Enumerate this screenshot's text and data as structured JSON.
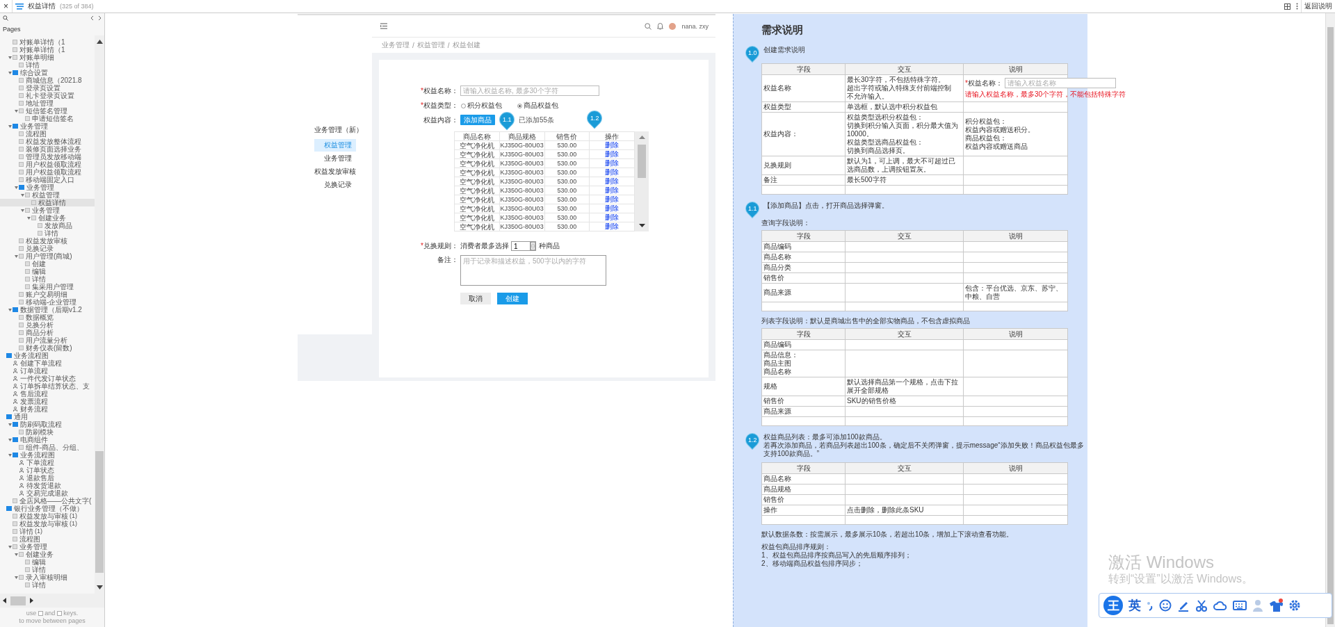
{
  "topbar": {
    "close": "×",
    "page_title": "权益详情",
    "page_count": "(325 of 384)",
    "action": "返回说明"
  },
  "sidebar": {
    "pages_label": "Pages",
    "scrolled_branch": [
      {
        "label": "对账单详情（1",
        "kind": "page",
        "selected": false
      },
      {
        "label": "对账单详情（1",
        "kind": "page",
        "selected": false
      },
      {
        "label": "对账单明细",
        "kind": "page",
        "selected": false,
        "expanded": true,
        "children": [
          {
            "label": "详情",
            "kind": "page",
            "selected": false
          }
        ]
      },
      {
        "label": "综合设置",
        "kind": "folder",
        "selected": false,
        "expanded": true,
        "children": [
          {
            "label": "商城信息（2021.8",
            "kind": "page",
            "selected": false
          },
          {
            "label": "登录页设置",
            "kind": "page",
            "selected": false
          },
          {
            "label": "礼卡登录页设置",
            "kind": "page",
            "selected": false
          },
          {
            "label": "地址管理",
            "kind": "page",
            "selected": false
          },
          {
            "label": "短信签名管理",
            "kind": "page",
            "selected": false,
            "expanded": true,
            "children": [
              {
                "label": "申请短信签名",
                "kind": "page",
                "selected": false
              }
            ]
          }
        ]
      },
      {
        "label": "业务管理",
        "kind": "folder",
        "selected": false,
        "expanded": true,
        "children": [
          {
            "label": "流程图",
            "kind": "page",
            "selected": false
          },
          {
            "label": "权益发放整体流程",
            "kind": "page",
            "selected": false
          },
          {
            "label": "装修页面选择业务",
            "kind": "page",
            "selected": false
          },
          {
            "label": "管理员发放移动端",
            "kind": "page",
            "selected": false
          },
          {
            "label": "用户权益领取流程",
            "kind": "page",
            "selected": false
          },
          {
            "label": "用户权益领取流程",
            "kind": "page",
            "selected": false
          },
          {
            "label": "移动端固定入口",
            "kind": "page",
            "selected": false
          },
          {
            "label": "业务管理",
            "kind": "folder",
            "selected": false,
            "expanded": true,
            "children": [
              {
                "label": "权益管理",
                "kind": "page",
                "selected": false,
                "expanded": true,
                "children": [
                  {
                    "label": "权益详情",
                    "kind": "page",
                    "selected": true
                  }
                ]
              },
              {
                "label": "业务管理",
                "kind": "page",
                "selected": false,
                "expanded": true,
                "children": [
                  {
                    "label": "创建业务",
                    "kind": "page",
                    "selected": false,
                    "expanded": true,
                    "children": [
                      {
                        "label": "发放商品",
                        "kind": "page",
                        "selected": false
                      },
                      {
                        "label": "详情",
                        "kind": "page",
                        "selected": false
                      }
                    ]
                  }
                ]
              }
            ]
          },
          {
            "label": "权益发放审核",
            "kind": "page",
            "selected": false
          },
          {
            "label": "兑换记录",
            "kind": "page",
            "selected": false
          },
          {
            "label": "用户管理(商城)",
            "kind": "page",
            "selected": false,
            "expanded": true,
            "children": [
              {
                "label": "创建",
                "kind": "page",
                "selected": false
              },
              {
                "label": "编辑",
                "kind": "page",
                "selected": false
              },
              {
                "label": "详情",
                "kind": "page",
                "selected": false
              },
              {
                "label": "集采用户管理",
                "kind": "page",
                "selected": false
              }
            ]
          },
          {
            "label": "账户交易明细",
            "kind": "page",
            "selected": false
          },
          {
            "label": "移动端-企业管理",
            "kind": "page",
            "selected": false
          }
        ]
      },
      {
        "label": "数据管理（后期v1.2",
        "kind": "folder",
        "selected": false,
        "expanded": true,
        "children": [
          {
            "label": "数据概览",
            "kind": "page",
            "selected": false
          },
          {
            "label": "兑换分析",
            "kind": "page",
            "selected": false
          },
          {
            "label": "商品分析",
            "kind": "page",
            "selected": false
          },
          {
            "label": "用户流量分析",
            "kind": "page",
            "selected": false
          },
          {
            "label": "财务仪表(留数)",
            "kind": "page",
            "selected": false
          }
        ]
      }
    ],
    "tree": [
      {
        "label": "业务流程图",
        "kind": "folder",
        "selected": false,
        "children": [
          {
            "label": "创建下单流程",
            "kind": "flow",
            "selected": false
          },
          {
            "label": "订单流程",
            "kind": "flow",
            "selected": false
          },
          {
            "label": "一件代发订单状态",
            "kind": "flow",
            "selected": false
          },
          {
            "label": "订单拆单结算状态、支",
            "kind": "flow",
            "selected": false
          },
          {
            "label": "售后流程",
            "kind": "flow",
            "selected": false
          },
          {
            "label": "发票流程",
            "kind": "flow",
            "selected": false
          },
          {
            "label": "财务流程",
            "kind": "flow",
            "selected": false
          }
        ]
      },
      {
        "label": "通用",
        "kind": "folder",
        "selected": false,
        "children": [
          {
            "label": "防刷码取流程",
            "kind": "folder",
            "selected": false,
            "expanded": true,
            "children": [
              {
                "label": "防刷模块",
                "kind": "page",
                "selected": false
              }
            ]
          },
          {
            "label": "电商组件",
            "kind": "folder",
            "selected": false,
            "expanded": true,
            "children": [
              {
                "label": "组件-商品、分组、",
                "kind": "page",
                "selected": false
              }
            ]
          },
          {
            "label": "业务流程图",
            "kind": "folder",
            "selected": false,
            "expanded": true,
            "children": [
              {
                "label": "下单流程",
                "kind": "flow",
                "selected": false
              },
              {
                "label": "订单状态",
                "kind": "flow",
                "selected": false
              },
              {
                "label": "退款售后",
                "kind": "flow",
                "selected": false
              },
              {
                "label": "待发货退款",
                "kind": "flow",
                "selected": false
              },
              {
                "label": "交易完成退款",
                "kind": "flow",
                "selected": false
              }
            ]
          },
          {
            "label": "全店风格——公共文字(",
            "kind": "page",
            "selected": false
          }
        ]
      },
      {
        "label": "银行业务管理（不做）",
        "kind": "folder",
        "selected": false,
        "children": [
          {
            "label": "权益发放与审核",
            "count": "(1)",
            "kind": "page",
            "selected": false
          },
          {
            "label": "权益发放与审核",
            "count": "(1)",
            "kind": "page",
            "selected": false
          },
          {
            "label": "详情",
            "count": "(1)",
            "kind": "page",
            "selected": false
          },
          {
            "label": "流程图",
            "kind": "page",
            "selected": false
          },
          {
            "label": "业务管理",
            "kind": "page",
            "selected": false,
            "expanded": true,
            "children": [
              {
                "label": "创建业务",
                "kind": "page",
                "selected": false,
                "expanded": true,
                "children": [
                  {
                    "label": "编辑",
                    "kind": "page",
                    "selected": false
                  },
                  {
                    "label": "详情",
                    "kind": "page",
                    "selected": false
                  }
                ]
              },
              {
                "label": "录入审核明细",
                "kind": "page",
                "selected": false,
                "expanded": true,
                "children": [
                  {
                    "label": "详情",
                    "kind": "page",
                    "selected": false
                  }
                ]
              }
            ]
          }
        ]
      }
    ],
    "hint": {
      "use": "use",
      "and": "and",
      "keys": "keys.",
      "tail": "to move between pages"
    }
  },
  "prototype": {
    "header": {
      "user_name": "nana. zxy"
    },
    "breadcrumb": [
      {
        "label": "业务管理",
        "separator": "/"
      },
      {
        "label": "权益管理",
        "separator": "/"
      },
      {
        "label": "权益创建"
      }
    ],
    "nav": {
      "title": "业务管理（新）",
      "items": [
        {
          "label": "权益管理",
          "selected": true
        },
        {
          "label": "业务管理",
          "selected": false
        },
        {
          "label": "权益发放审核",
          "selected": false
        },
        {
          "label": "兑换记录",
          "selected": false
        }
      ]
    },
    "form": {
      "name": {
        "required_mark": "*",
        "label": "权益名称：",
        "placeholder": "请输入权益名称, 最多30个字符"
      },
      "type": {
        "required_mark": "*",
        "label": "权益类型：",
        "options": [
          {
            "label": "积分权益包",
            "selected": false
          },
          {
            "label": "商品权益包",
            "selected": true
          }
        ]
      },
      "content": {
        "label": "权益内容：",
        "button": "添加商品",
        "count": "已添加55条",
        "table": {
          "columns": [
            "商品名称",
            "商品规格",
            "销售价",
            "操作"
          ],
          "rows": [
            [
              "空气净化机",
              "KJ350G-80U03",
              "530.00",
              "删除"
            ],
            [
              "空气净化机",
              "KJ350G-80U03",
              "530.00",
              "删除"
            ],
            [
              "空气净化机",
              "KJ350G-80U03",
              "530.00",
              "删除"
            ],
            [
              "空气净化机",
              "KJ350G-80U03",
              "530.00",
              "删除"
            ],
            [
              "空气净化机",
              "KJ350G-80U03",
              "530.00",
              "删除"
            ],
            [
              "空气净化机",
              "KJ350G-80U03",
              "530.00",
              "删除"
            ],
            [
              "空气净化机",
              "KJ350G-80U03",
              "530.00",
              "删除"
            ],
            [
              "空气净化机",
              "KJ350G-80U03",
              "530.00",
              "删除"
            ],
            [
              "空气净化机",
              "KJ350G-80U03",
              "530.00",
              "删除"
            ],
            [
              "空气净化机",
              "KJ350G-80U03",
              "530.00",
              "删除"
            ]
          ]
        }
      },
      "rule": {
        "required_mark": "*",
        "label": "兑换规则：",
        "prefix": "消费者最多选择",
        "value": "1",
        "suffix": "种商品"
      },
      "remark": {
        "label": "备注：",
        "placeholder": "用于记录和描述权益，500字以内的字符"
      },
      "buttons": [
        {
          "label": "取消",
          "kind": "secondary"
        },
        {
          "label": "创建",
          "kind": "primary"
        }
      ]
    },
    "markers": [
      "1.1",
      "1.2"
    ]
  },
  "spec": {
    "title": "需求说明",
    "sections": [
      {
        "marker": "1.0",
        "heading": "创建需求说明",
        "blocks": [
          {
            "kind": "table",
            "columns": [
              "字段",
              "交互",
              "说明"
            ],
            "rows": [
              {
                "field": "权益名称",
                "interaction": [
                  "最长30字符，不包括特殊字符。",
                  "超出字符或输入特殊支付前端控制",
                  "不允许输入。"
                ],
                "note_form": {
                  "required_mark": "*",
                  "label": "权益名称：",
                  "placeholder": "请输入权益名称",
                  "error": "请输入权益名称，最多30个字符，不能包括特殊字符"
                }
              },
              {
                "field": "权益类型",
                "interaction": "单选框，默认选中积分权益包"
              },
              {
                "field": "权益内容：",
                "interaction": [
                  "权益类型选积分权益包：",
                  "切换到积分输入页面，积分最大值为10000。",
                  "权益类型选商品权益包：",
                  "切换到商品选择页。"
                ],
                "note": [
                  "积分权益包：",
                  "权益内容或赠送积分。",
                  "商品权益包：",
                  "权益内容或赠送商品"
                ]
              },
              {
                "field": "兑换规则",
                "interaction": "默认为1，可上调，最大不可超过已选商品数，上调按钮置灰。"
              },
              {
                "field": "备注",
                "interaction": "最长500字符"
              }
            ]
          }
        ]
      },
      {
        "marker": "1.1",
        "heading": "【添加商品】点击，打开商品选择弹窗。",
        "blocks": [
          {
            "kind": "text",
            "text": "查询字段说明："
          },
          {
            "kind": "table",
            "columns": [
              "字段",
              "交互",
              "说明"
            ],
            "rows": [
              {
                "field": "商品编码"
              },
              {
                "field": "商品名称"
              },
              {
                "field": "商品分类"
              },
              {
                "field": "销售价"
              },
              {
                "field": "商品来源",
                "note": "包含：平台优选、京东、苏宁、中粮、自营"
              }
            ]
          },
          {
            "kind": "text",
            "text": "列表字段说明：默认是商城出售中的全部实物商品，不包含虚拟商品"
          },
          {
            "kind": "table",
            "columns": [
              "字段",
              "交互",
              "说明"
            ],
            "rows": [
              {
                "field": "商品编码"
              },
              {
                "field": [
                  "商品信息：",
                  "商品主图",
                  "商品名称"
                ]
              },
              {
                "field": "规格",
                "interaction": "默认选择商品第一个规格，点击下拉展开全部规格"
              },
              {
                "field": "销售价",
                "interaction": "SKU的销售价格"
              },
              {
                "field": "商品来源"
              }
            ]
          }
        ]
      },
      {
        "marker": "1.2",
        "heading": [
          "权益商品列表：最多可添加100款商品。",
          "若再次添加商品，若商品列表超出100条，确定后不关闭弹窗，提示message“添加失败！商品权益包最多支持100款商品。”"
        ],
        "blocks": [
          {
            "kind": "table",
            "columns": [
              "字段",
              "交互",
              "说明"
            ],
            "rows": [
              {
                "field": "商品名称"
              },
              {
                "field": "商品规格"
              },
              {
                "field": "销售价"
              },
              {
                "field": "操作",
                "interaction": "点击删除，删除此条SKU"
              }
            ]
          },
          {
            "kind": "text",
            "text": "默认数据条数：按需展示，最多展示10条，若超出10条，增加上下滚动查看功能。"
          },
          {
            "kind": "text",
            "text": [
              "权益包商品排序规则：",
              "1、权益包商品排序按商品写入的先后顺序排列；",
              "2、移动端商品权益包排序同步；"
            ]
          }
        ]
      }
    ]
  },
  "os_overlay": {
    "activation_title": "激活 Windows",
    "activation_hint": "转到“设置”以激活 Windows。"
  },
  "ime_toolbar": {
    "logo": "王",
    "mode": "英"
  }
}
